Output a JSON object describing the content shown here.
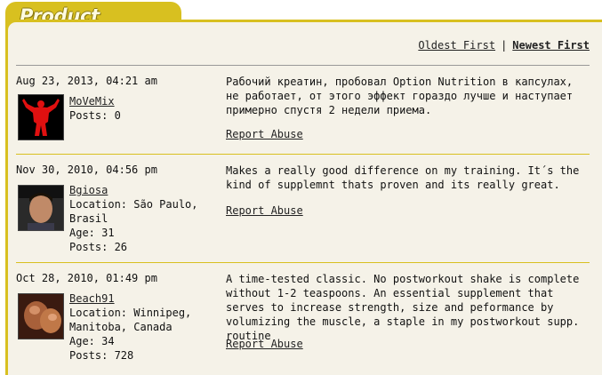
{
  "header": {
    "title": "Product Reviews"
  },
  "sort": {
    "oldest_label": "Oldest First",
    "separator": "|",
    "newest_label": "Newest First"
  },
  "reviews": [
    {
      "date": "Aug 23, 2013, 04:21 am",
      "username": "MoVeMix",
      "details": [
        "Posts: 0"
      ],
      "text": "Рабочий креатин, пробовал Option Nutrition в капсулах, не работает, от этого эффект гораздо лучше и наступает примерно спустя 2 недели приема.",
      "report_label": "Report Abuse"
    },
    {
      "date": "Nov 30, 2010, 04:56 pm",
      "username": "Bgiosa",
      "details": [
        "Location: São Paulo,",
        "Brasil",
        "Age: 31",
        "Posts: 26"
      ],
      "text": "Makes a really good difference on my training. It´s the kind of supplemnt thats proven and its really great.",
      "report_label": "Report Abuse"
    },
    {
      "date": "Oct 28, 2010, 01:49 pm",
      "username": "Beach91",
      "details": [
        "Location: Winnipeg,",
        "Manitoba, Canada",
        "Age: 34",
        "Posts: 728"
      ],
      "text": "A time-tested classic. No postworkout shake is complete without 1-2 teaspoons. An essential supplement that serves to increase strength, size and peformance by volumizing the muscle, a staple in my postworkout supp. routine",
      "report_label": "Report Abuse"
    }
  ]
}
